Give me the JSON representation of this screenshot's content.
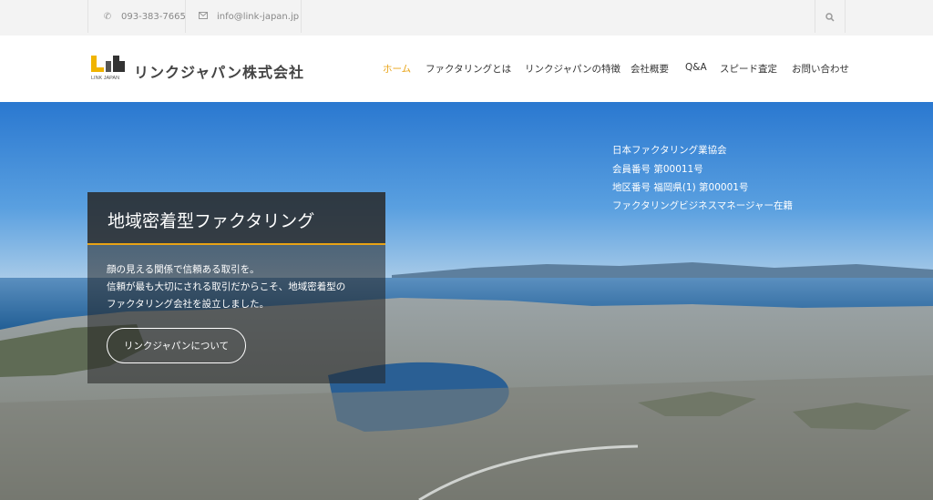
{
  "topbar": {
    "phone": "093-383-7665",
    "email": "info@link-japan.jp",
    "phone_icon": "phone-icon",
    "email_icon": "mail-icon",
    "search_icon": "search-icon"
  },
  "brand": {
    "name": "リンクジャパン株式会社",
    "logo_caption": "LINK JAPAN"
  },
  "nav": [
    "ホーム",
    "ファクタリングとは",
    "リンクジャパンの特徴",
    "会社概要",
    "Q&A",
    "スピード査定",
    "お問い合わせ"
  ],
  "hero": {
    "info_lines": [
      "日本ファクタリング業協会",
      "会員番号 第00011号",
      "地区番号 福岡県(1) 第00001号",
      "ファクタリングビジネスマネージャー在籍"
    ],
    "card_title": "地域密着型ファクタリング",
    "card_lines": [
      "顔の見える関係で信頼ある取引を。",
      "信頼が最も大切にされる取引だからこそ、地域密着型の",
      "ファクタリング会社を設立しました。"
    ],
    "button_label": "リンクジャパンについて"
  },
  "colors": {
    "accent": "#e8a316",
    "sky_top": "#2f7fd4",
    "sea": "#1f5c93"
  }
}
